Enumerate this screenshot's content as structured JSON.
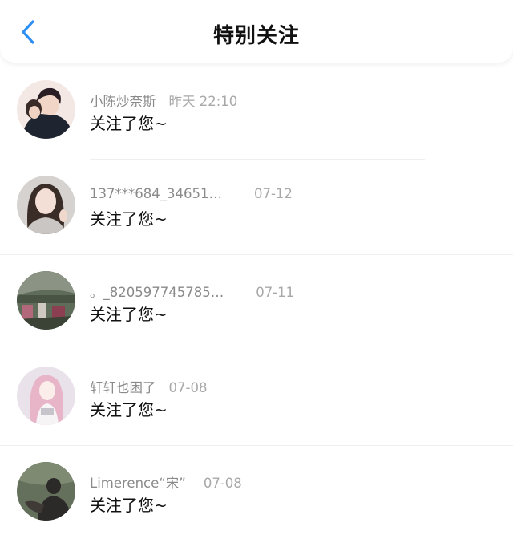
{
  "header": {
    "title": "特别关注",
    "back_icon": "chevron-left-icon",
    "accent_color": "#2f8ff5"
  },
  "notifications": [
    {
      "name": "小陈炒奈斯",
      "time": "昨天 22:10",
      "action": "关注了您~",
      "avatar_colors": [
        "#f4e8e5",
        "#2a1e24"
      ]
    },
    {
      "name": "137***684_34651…",
      "time": "07-12",
      "action": "关注了您~",
      "avatar_colors": [
        "#d6d2cf",
        "#3a2c26"
      ]
    },
    {
      "name": "。_820597745785…",
      "time": "07-11",
      "action": "关注了您~",
      "avatar_colors": [
        "#5f6c5a",
        "#b2687a"
      ]
    },
    {
      "name": "轩轩也困了",
      "time": "07-08",
      "action": "关注了您~",
      "avatar_colors": [
        "#e9e2ea",
        "#e7b5c7"
      ]
    },
    {
      "name": "Limerence“宋”",
      "time": "07-08",
      "action": "关注了您~",
      "avatar_colors": [
        "#64705b",
        "#2c2a28"
      ]
    }
  ]
}
